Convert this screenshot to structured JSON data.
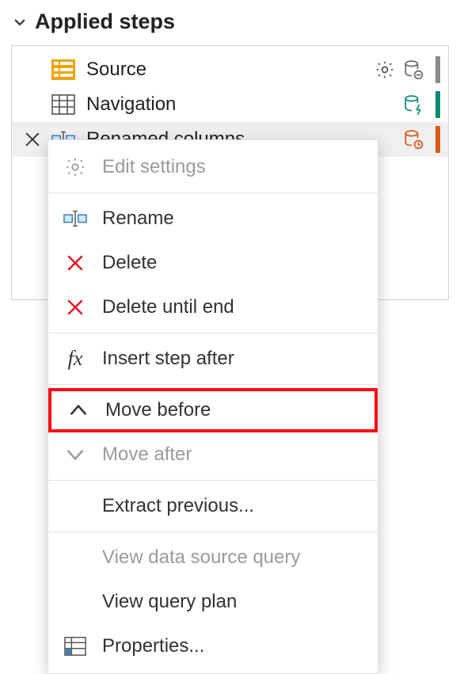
{
  "section": {
    "title": "Applied steps"
  },
  "steps": [
    {
      "label": "Source",
      "bar_color": "#8a8a8a"
    },
    {
      "label": "Navigation",
      "bar_color": "#0f8a72"
    },
    {
      "label": "Renamed columns",
      "bar_color": "#d75a17"
    }
  ],
  "context_menu": {
    "edit_settings": "Edit settings",
    "rename": "Rename",
    "delete": "Delete",
    "delete_until_end": "Delete until end",
    "insert_step_after": "Insert step after",
    "move_before": "Move before",
    "move_after": "Move after",
    "extract_previous": "Extract previous...",
    "view_data_source": "View data source query",
    "view_query_plan": "View query plan",
    "properties": "Properties..."
  },
  "colors": {
    "source_icon": "#f2a100",
    "red_x": "#e81123",
    "teal": "#0f8a72",
    "orange": "#d75a17",
    "grey": "#8a8a8a"
  }
}
